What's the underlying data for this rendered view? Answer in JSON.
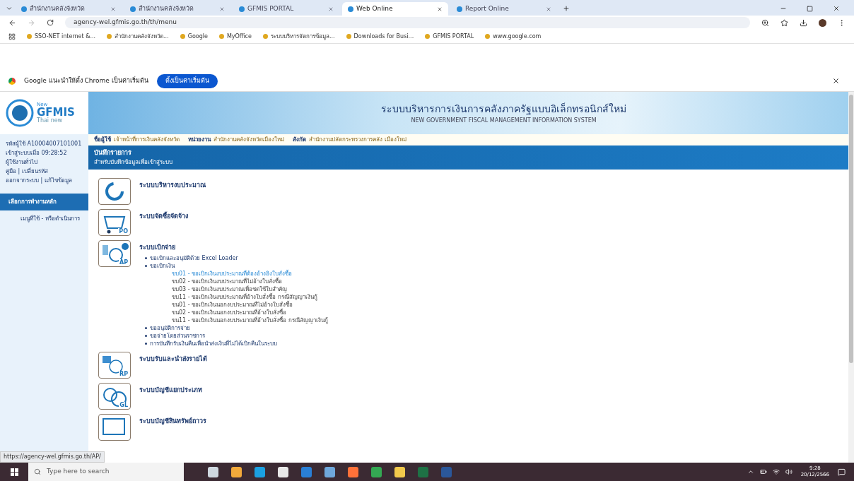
{
  "browser": {
    "tabs": [
      {
        "label": "สำนักงานคลังจังหวัด",
        "selected": false
      },
      {
        "label": "สำนักงานคลังจังหวัด",
        "selected": false
      },
      {
        "label": "GFMIS PORTAL",
        "selected": false
      },
      {
        "label": "Web Online",
        "selected": true
      },
      {
        "label": "Report Online",
        "selected": false
      }
    ],
    "url": "agency-wel.gfmis.go.th/th/menu",
    "bookmarks": [
      "SSO-NET internet &...",
      "สำนักงานคลังจังหวัด...",
      "Google",
      "MyOffice",
      "ระบบบริหารจัดการข้อมูล...",
      "Downloads for Busi...",
      "GFMIS PORTAL",
      "www.google.com"
    ],
    "infobar": {
      "message": "Google แนะนำให้ตั้ง Chrome เป็นค่าเริ่มต้น",
      "button": "ตั้งเป็นค่าเริ่มต้น"
    }
  },
  "page": {
    "logo": {
      "new": "New",
      "brand": "GFMIS",
      "tagline": "Thai new"
    },
    "header": {
      "title_th": "ระบบบริหารการเงินการคลังภาครัฐแบบอิเล็กทรอนิกส์ใหม่",
      "title_en": "NEW GOVERNMENT FISCAL MANAGEMENT INFORMATION SYSTEM"
    },
    "user_info": [
      "รหัสผู้ใช้ A10004007101001",
      "เข้าสู่ระบบเมื่อ 09:28:52",
      "ผู้ใช้งานทั่วไป",
      "คู่มือ | เปลี่ยนรหัส",
      "ออกจากระบบ | แก้ไขข้อมูล"
    ],
    "sidebar": {
      "items": [
        {
          "label": "เลือกการทำงานหลัก",
          "selected": true
        },
        {
          "label": "เมนูที่ใช้ - หรือดำเนินการ",
          "selected": false
        }
      ]
    },
    "breadcrumb": [
      {
        "label": "ชื่อผู้ใช้",
        "value": "เจ้าหน้าที่การเงินคลังจังหวัด"
      },
      {
        "label": "หน่วยงาน",
        "value": "สำนักงานคลังจังหวัดเมืองใหม่"
      },
      {
        "label": "สังกัด",
        "value": "สำนักงานปลัดกระทรวงการคลัง เมืองใหม่"
      }
    ],
    "section": {
      "title": "บันทึกรายการ",
      "subtitle": "สำหรับบันทึกข้อมูลเพื่อเข้าสู่ระบบ"
    },
    "modules": [
      {
        "kind": "budget",
        "name": "ระบบบริหารงบประมาณ"
      },
      {
        "kind": "procurement",
        "icon_text": "PO",
        "name": "ระบบจัดซื้อจัดจ้าง"
      },
      {
        "kind": "payment",
        "icon_text": "AP",
        "name": "ระบบเบิกจ่าย",
        "children": [
          {
            "label": "ขอเบิกและอนุมัติด้วย Excel Loader"
          },
          {
            "label": "ขอเบิกเงิน",
            "children": [
              {
                "label": "ขบ01 - ขอเบิกเงินงบประมาณที่ต้องอ้างอิงใบสั่งซื้อ",
                "selected": true
              },
              {
                "label": "ขบ02 - ขอเบิกเงินงบประมาณที่ไม่อ้างใบสั่งซื้อ",
                "selected": false
              },
              {
                "label": "ขบ03 - ขอเบิกเงินงบประมาณเพื่อชดใช้ใบสำคัญ",
                "selected": false
              },
              {
                "label": "ขบ11 - ขอเบิกเงินงบประมาณที่อ้างใบสั่งซื้อ กรณีสัญญาเงินกู้",
                "selected": false
              },
              {
                "label": "ขน01 - ขอเบิกเงินนอกงบประมาณที่ไม่อ้างใบสั่งซื้อ",
                "selected": false
              },
              {
                "label": "ขน02 - ขอเบิกเงินนอกงบประมาณที่อ้างใบสั่งซื้อ",
                "selected": false
              },
              {
                "label": "ขน11 - ขอเบิกเงินนอกงบประมาณที่อ้างใบสั่งซื้อ กรณีสัญญาเงินกู้",
                "selected": false
              }
            ]
          },
          {
            "label": "ขออนุมัติการจ่าย"
          },
          {
            "label": "ขอจ่ายโดยส่วนราชการ"
          },
          {
            "label": "การบันทึกรับเงินคืนเพื่อนำส่งเงินที่ไม่ได้เบิกคืนในระบบ"
          }
        ]
      },
      {
        "kind": "revenue",
        "icon_text": "RP",
        "name": "ระบบรับและนำส่งรายได้"
      },
      {
        "kind": "ledger",
        "icon_text": "GL",
        "name": "ระบบบัญชีแยกประเภท"
      },
      {
        "kind": "asset",
        "name": "ระบบบัญชีสินทรัพย์ถาวร"
      }
    ],
    "status_url": "https://agency-wel.gfmis.go.th/AP/"
  },
  "taskbar": {
    "search_placeholder": "Type here to search",
    "time": "9:28",
    "date": "20/12/2566"
  }
}
